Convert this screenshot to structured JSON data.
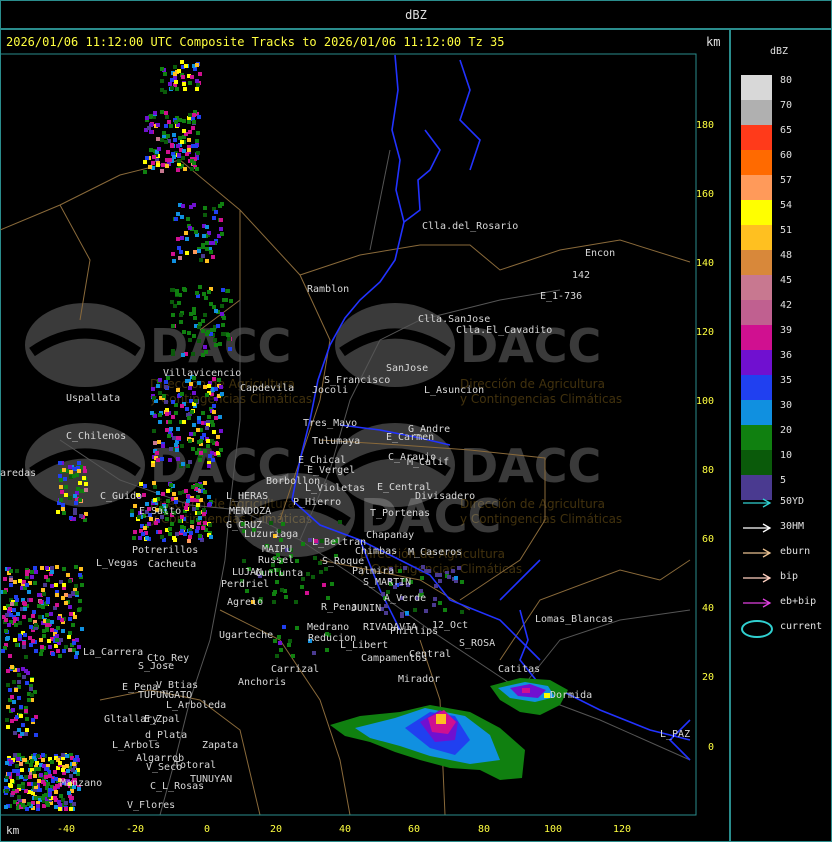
{
  "title_bar": "dBZ",
  "header": "2026/01/06 11:12:00 UTC Composite Tracks to 2026/01/06 11:12:00 Tz 35",
  "km_top": "km",
  "km_bottom": "km",
  "colors": {
    "frame": "#2a8c8c",
    "header_text": "#ffff40",
    "province_border": "#2233ff",
    "dept_border": "#8a6a3a",
    "road": "#5a5a5a",
    "label": "#d8d8d8"
  },
  "y_axis": [
    "180",
    "160",
    "140",
    "120",
    "100",
    "80",
    "60",
    "40",
    "20",
    "0"
  ],
  "x_axis": [
    "-40",
    "-20",
    "0",
    "20",
    "40",
    "60",
    "80",
    "100",
    "120"
  ],
  "legend": {
    "title": "dBZ",
    "items": [
      {
        "value": "80",
        "color": "#d8d8d8"
      },
      {
        "value": "70",
        "color": "#b0b0b0"
      },
      {
        "value": "65",
        "color": "#ff3a1a"
      },
      {
        "value": "60",
        "color": "#ff6a00"
      },
      {
        "value": "57",
        "color": "#ff9a5a"
      },
      {
        "value": "54",
        "color": "#ffff00"
      },
      {
        "value": "51",
        "color": "#ffc020"
      },
      {
        "value": "48",
        "color": "#d8883a"
      },
      {
        "value": "45",
        "color": "#c87890"
      },
      {
        "value": "42",
        "color": "#c06090"
      },
      {
        "value": "39",
        "color": "#d01090"
      },
      {
        "value": "36",
        "color": "#7010d0"
      },
      {
        "value": "35",
        "color": "#2040f0"
      },
      {
        "value": "30",
        "color": "#1090e0"
      },
      {
        "value": "20",
        "color": "#108010"
      },
      {
        "value": "10",
        "color": "#0a5a0a"
      },
      {
        "value": "5",
        "color": "#4a3a90"
      }
    ]
  },
  "tracks": [
    {
      "label": "50YD",
      "color": "#30d0d0"
    },
    {
      "label": "30HM",
      "color": "#ffffff"
    },
    {
      "label": "eburn",
      "color": "#e8c090"
    },
    {
      "label": "bip",
      "color": "#ffd0c0"
    },
    {
      "label": "eb+bip",
      "color": "#e040e0"
    },
    {
      "label": "current",
      "color": "#30d0d0"
    }
  ],
  "places": [
    {
      "name": "Clla.del_Rosario"
    },
    {
      "name": "Encon"
    },
    {
      "name": "142"
    },
    {
      "name": "E_1-736"
    },
    {
      "name": "Ramblon"
    },
    {
      "name": "Clla.SanJose"
    },
    {
      "name": "Clla.El_Cavadito"
    },
    {
      "name": "Villavicencio"
    },
    {
      "name": "Uspallata"
    },
    {
      "name": "Capdevila"
    },
    {
      "name": "S_Francisco"
    },
    {
      "name": "Jocoli"
    },
    {
      "name": "SanJose"
    },
    {
      "name": "L_Asuncion"
    },
    {
      "name": "C_Chilenos"
    },
    {
      "name": "Tres_Mayo"
    },
    {
      "name": "Tulumaya"
    },
    {
      "name": "G_Andre"
    },
    {
      "name": "E_Carmen"
    },
    {
      "name": "E_Chical"
    },
    {
      "name": "C_Araujo"
    },
    {
      "name": "M_Calif"
    },
    {
      "name": "E_Vergel"
    },
    {
      "name": "Borbollon"
    },
    {
      "name": "L_Violetas"
    },
    {
      "name": "E_Central"
    },
    {
      "name": "Divisadero"
    },
    {
      "name": "C_Guido"
    },
    {
      "name": "L_HERAS"
    },
    {
      "name": "P_Hierro"
    },
    {
      "name": "T_Portenas"
    },
    {
      "name": "E_Salto"
    },
    {
      "name": "MENDOZA"
    },
    {
      "name": "G_CRUZ"
    },
    {
      "name": "Luzuriaga"
    },
    {
      "name": "Chapanay"
    },
    {
      "name": "L_Beltran"
    },
    {
      "name": "Chimbas"
    },
    {
      "name": "M_Caseros"
    },
    {
      "name": "Potrerillos"
    },
    {
      "name": "MAIPU"
    },
    {
      "name": "Russel"
    },
    {
      "name": "S_Roque"
    },
    {
      "name": "L_Vegas"
    },
    {
      "name": "Cacheuta"
    },
    {
      "name": "LUJAN"
    },
    {
      "name": "Cunlunta"
    },
    {
      "name": "Palmira"
    },
    {
      "name": "S_MARTIN"
    },
    {
      "name": "Perdriel"
    },
    {
      "name": "A_Verde"
    },
    {
      "name": "Reducion"
    },
    {
      "name": "Agrelo"
    },
    {
      "name": "R_Pena"
    },
    {
      "name": "JUNIN"
    },
    {
      "name": "Ugarteche"
    },
    {
      "name": "Medrano"
    },
    {
      "name": "RIVADAVIA"
    },
    {
      "name": "Phillips"
    },
    {
      "name": "12_Oct"
    },
    {
      "name": "S_ROSA"
    },
    {
      "name": "Lomas_Blancas"
    },
    {
      "name": "La_Carrera"
    },
    {
      "name": "Cto_Rey"
    },
    {
      "name": "L_Libert"
    },
    {
      "name": "Campamentos"
    },
    {
      "name": "Central"
    },
    {
      "name": "S_Jose"
    },
    {
      "name": "Carrizal"
    },
    {
      "name": "Catitas"
    },
    {
      "name": "E_Pena"
    },
    {
      "name": "V_Btias"
    },
    {
      "name": "Anchoris"
    },
    {
      "name": "TUPUNGATO"
    },
    {
      "name": "Mirador"
    },
    {
      "name": "Dormida"
    },
    {
      "name": "L_Arboleda"
    },
    {
      "name": "Gltallary"
    },
    {
      "name": "E_Zpal"
    },
    {
      "name": "L_PAZ"
    },
    {
      "name": "d_Plata"
    },
    {
      "name": "L_Arbols"
    },
    {
      "name": "Zapata"
    },
    {
      "name": "Algarrob"
    },
    {
      "name": "Manzano"
    },
    {
      "name": "V_Seco"
    },
    {
      "name": "Totoral"
    },
    {
      "name": "TUNUYAN"
    },
    {
      "name": "C_L_Rosas"
    },
    {
      "name": "V_Flores"
    },
    {
      "name": "aredas"
    }
  ],
  "watermark": {
    "name": "DACC",
    "line1": "Dirección de Agricultura",
    "line2": "y Contingencias Climáticas"
  }
}
